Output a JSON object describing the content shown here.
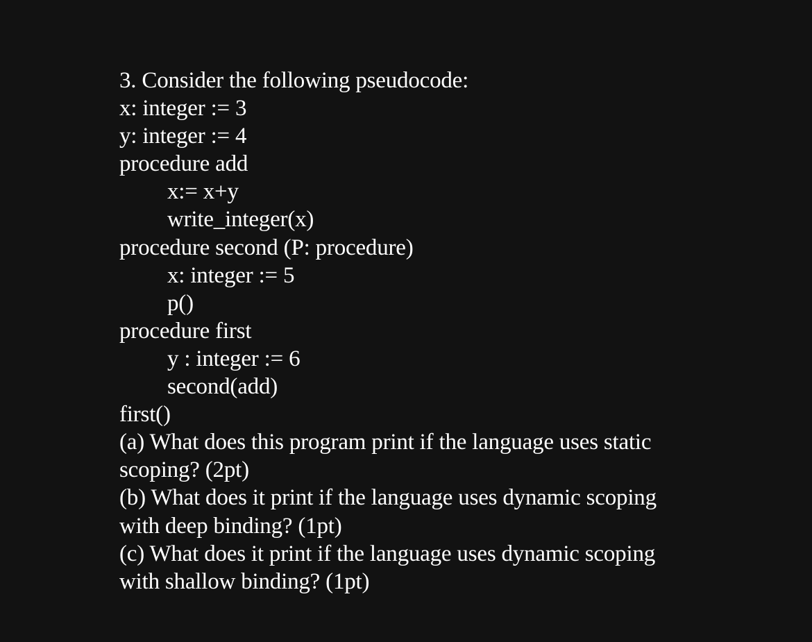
{
  "question": {
    "heading": "3. Consider the following pseudocode:",
    "code_lines": [
      {
        "text": "x: integer := 3",
        "indent": 0
      },
      {
        "text": "y: integer := 4",
        "indent": 0
      },
      {
        "text": "procedure add",
        "indent": 0
      },
      {
        "text": "x:= x+y",
        "indent": 1
      },
      {
        "text": "write_integer(x)",
        "indent": 1
      },
      {
        "text": "procedure second (P: procedure)",
        "indent": 0
      },
      {
        "text": "x: integer := 5",
        "indent": 1
      },
      {
        "text": "p()",
        "indent": 1
      },
      {
        "text": "procedure first",
        "indent": 0
      },
      {
        "text": "y : integer := 6",
        "indent": 1
      },
      {
        "text": "second(add)",
        "indent": 1
      },
      {
        "text": "first()",
        "indent": 0
      }
    ],
    "parts": [
      {
        "line1": "(a) What does this program print if the language uses static",
        "line2": "scoping? (2pt)"
      },
      {
        "line1": "(b) What does it print if the language uses dynamic scoping",
        "line2": "with deep binding? (1pt)"
      },
      {
        "line1": "(c) What does it print if the language uses dynamic scoping",
        "line2": "with shallow binding? (1pt)"
      }
    ]
  }
}
